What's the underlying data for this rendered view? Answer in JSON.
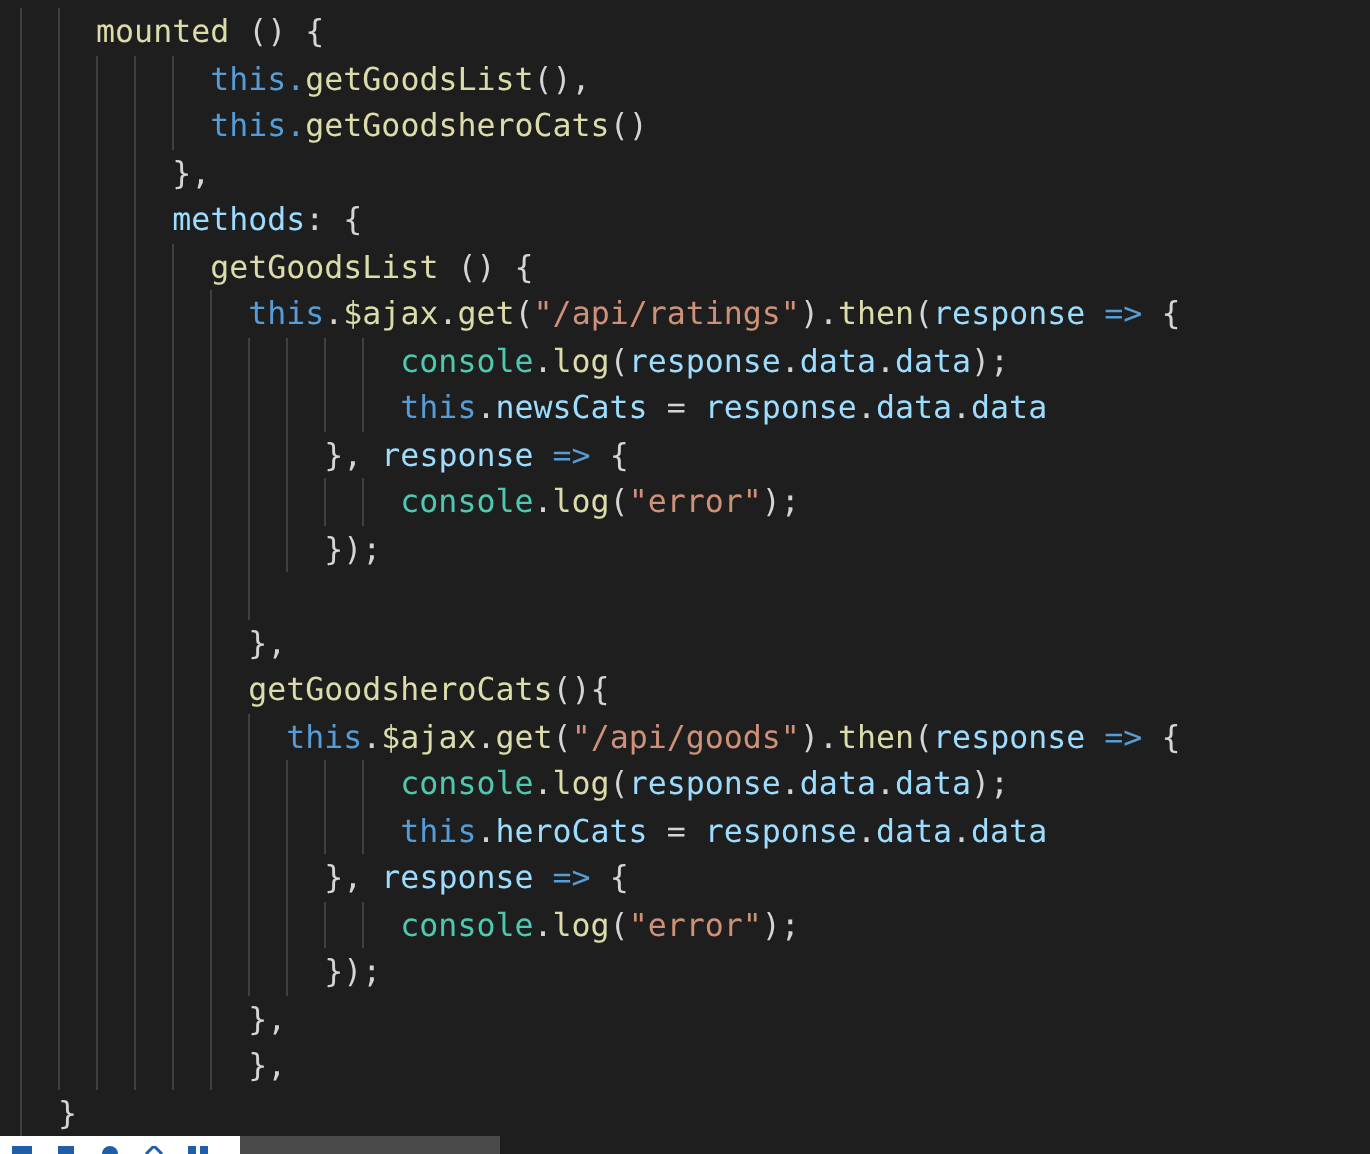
{
  "editor": {
    "lines": [
      {
        "kind": "code",
        "tokens": [
          {
            "kind": "fn",
            "text": "    mounted"
          },
          {
            "kind": "punct",
            "text": " () {"
          }
        ]
      },
      {
        "kind": "code",
        "tokens": [
          {
            "kind": "kw",
            "text": "          this."
          },
          {
            "kind": "fn",
            "text": "getGoodsList"
          },
          {
            "kind": "punct",
            "text": "(),"
          }
        ]
      },
      {
        "kind": "code",
        "tokens": [
          {
            "kind": "kw",
            "text": "          this."
          },
          {
            "kind": "fn",
            "text": "getGoodsheroCats"
          },
          {
            "kind": "punct",
            "text": "()"
          }
        ]
      },
      {
        "kind": "code",
        "tokens": [
          {
            "kind": "punct",
            "text": "        },"
          }
        ]
      },
      {
        "kind": "code",
        "tokens": [
          {
            "kind": "var",
            "text": "        methods"
          },
          {
            "kind": "punct",
            "text": ": {"
          }
        ]
      },
      {
        "kind": "code",
        "tokens": [
          {
            "kind": "fn",
            "text": "          getGoodsList"
          },
          {
            "kind": "punct",
            "text": " () {"
          }
        ]
      },
      {
        "kind": "code",
        "tokens": [
          {
            "kind": "kw",
            "text": "            this"
          },
          {
            "kind": "punct",
            "text": "."
          },
          {
            "kind": "fn",
            "text": "$ajax"
          },
          {
            "kind": "punct",
            "text": "."
          },
          {
            "kind": "fn",
            "text": "get"
          },
          {
            "kind": "punct",
            "text": "("
          },
          {
            "kind": "str",
            "text": "\"/api/ratings\""
          },
          {
            "kind": "punct",
            "text": ")."
          },
          {
            "kind": "fn",
            "text": "then"
          },
          {
            "kind": "punct",
            "text": "("
          },
          {
            "kind": "var",
            "text": "response"
          },
          {
            "kind": "kw",
            "text": " =>"
          },
          {
            "kind": "punct",
            "text": " {"
          }
        ]
      },
      {
        "kind": "code",
        "tokens": [
          {
            "kind": "cls",
            "text": "                    console"
          },
          {
            "kind": "punct",
            "text": "."
          },
          {
            "kind": "fn",
            "text": "log"
          },
          {
            "kind": "punct",
            "text": "("
          },
          {
            "kind": "var",
            "text": "response"
          },
          {
            "kind": "punct",
            "text": "."
          },
          {
            "kind": "var",
            "text": "data"
          },
          {
            "kind": "punct",
            "text": "."
          },
          {
            "kind": "var",
            "text": "data"
          },
          {
            "kind": "punct",
            "text": ");"
          }
        ]
      },
      {
        "kind": "code",
        "tokens": [
          {
            "kind": "kw",
            "text": "                    this"
          },
          {
            "kind": "punct",
            "text": "."
          },
          {
            "kind": "var",
            "text": "newsCats"
          },
          {
            "kind": "punct",
            "text": " = "
          },
          {
            "kind": "var",
            "text": "response"
          },
          {
            "kind": "punct",
            "text": "."
          },
          {
            "kind": "var",
            "text": "data"
          },
          {
            "kind": "punct",
            "text": "."
          },
          {
            "kind": "var",
            "text": "data"
          }
        ]
      },
      {
        "kind": "code",
        "tokens": [
          {
            "kind": "punct",
            "text": "                }, "
          },
          {
            "kind": "var",
            "text": "response"
          },
          {
            "kind": "kw",
            "text": " =>"
          },
          {
            "kind": "punct",
            "text": " {"
          }
        ]
      },
      {
        "kind": "code",
        "tokens": [
          {
            "kind": "cls",
            "text": "                    console"
          },
          {
            "kind": "punct",
            "text": "."
          },
          {
            "kind": "fn",
            "text": "log"
          },
          {
            "kind": "punct",
            "text": "("
          },
          {
            "kind": "str",
            "text": "\"error\""
          },
          {
            "kind": "punct",
            "text": ");"
          }
        ]
      },
      {
        "kind": "code",
        "tokens": [
          {
            "kind": "punct",
            "text": "                });"
          }
        ]
      },
      {
        "kind": "blank"
      },
      {
        "kind": "code",
        "tokens": [
          {
            "kind": "punct",
            "text": "            },"
          }
        ]
      },
      {
        "kind": "code",
        "tokens": [
          {
            "kind": "fn",
            "text": "            getGoodsheroCats"
          },
          {
            "kind": "punct",
            "text": "(){"
          }
        ]
      },
      {
        "kind": "code",
        "tokens": [
          {
            "kind": "kw",
            "text": "              this"
          },
          {
            "kind": "punct",
            "text": "."
          },
          {
            "kind": "fn",
            "text": "$ajax"
          },
          {
            "kind": "punct",
            "text": "."
          },
          {
            "kind": "fn",
            "text": "get"
          },
          {
            "kind": "punct",
            "text": "("
          },
          {
            "kind": "str",
            "text": "\"/api/goods\""
          },
          {
            "kind": "punct",
            "text": ")."
          },
          {
            "kind": "fn",
            "text": "then"
          },
          {
            "kind": "punct",
            "text": "("
          },
          {
            "kind": "var",
            "text": "response"
          },
          {
            "kind": "kw",
            "text": " =>"
          },
          {
            "kind": "punct",
            "text": " {"
          }
        ]
      },
      {
        "kind": "code",
        "tokens": [
          {
            "kind": "cls",
            "text": "                    console"
          },
          {
            "kind": "punct",
            "text": "."
          },
          {
            "kind": "fn",
            "text": "log"
          },
          {
            "kind": "punct",
            "text": "("
          },
          {
            "kind": "var",
            "text": "response"
          },
          {
            "kind": "punct",
            "text": "."
          },
          {
            "kind": "var",
            "text": "data"
          },
          {
            "kind": "punct",
            "text": "."
          },
          {
            "kind": "var",
            "text": "data"
          },
          {
            "kind": "punct",
            "text": ");"
          }
        ]
      },
      {
        "kind": "code",
        "tokens": [
          {
            "kind": "kw",
            "text": "                    this"
          },
          {
            "kind": "punct",
            "text": "."
          },
          {
            "kind": "var",
            "text": "heroCats"
          },
          {
            "kind": "punct",
            "text": " = "
          },
          {
            "kind": "var",
            "text": "response"
          },
          {
            "kind": "punct",
            "text": "."
          },
          {
            "kind": "var",
            "text": "data"
          },
          {
            "kind": "punct",
            "text": "."
          },
          {
            "kind": "var",
            "text": "data"
          }
        ]
      },
      {
        "kind": "code",
        "tokens": [
          {
            "kind": "punct",
            "text": "                }, "
          },
          {
            "kind": "var",
            "text": "response"
          },
          {
            "kind": "kw",
            "text": " =>"
          },
          {
            "kind": "punct",
            "text": " {"
          }
        ]
      },
      {
        "kind": "code",
        "tokens": [
          {
            "kind": "cls",
            "text": "                    console"
          },
          {
            "kind": "punct",
            "text": "."
          },
          {
            "kind": "fn",
            "text": "log"
          },
          {
            "kind": "punct",
            "text": "("
          },
          {
            "kind": "str",
            "text": "\"error\""
          },
          {
            "kind": "punct",
            "text": ");"
          }
        ]
      },
      {
        "kind": "code",
        "tokens": [
          {
            "kind": "punct",
            "text": "                });"
          }
        ]
      },
      {
        "kind": "code",
        "tokens": [
          {
            "kind": "punct",
            "text": "            },"
          }
        ]
      },
      {
        "kind": "code",
        "tokens": [
          {
            "kind": "punct",
            "text": "            },"
          }
        ]
      },
      {
        "kind": "code",
        "tokens": [
          {
            "kind": "punct",
            "text": "  }"
          }
        ]
      }
    ]
  }
}
